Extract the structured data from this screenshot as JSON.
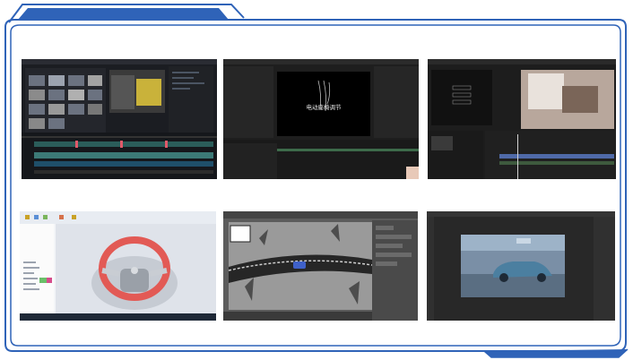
{
  "screenshots": [
    {
      "name": "video-editor-timeline"
    },
    {
      "name": "after-effects-title",
      "caption": "电动座椅调节"
    },
    {
      "name": "premiere-seat-edit"
    },
    {
      "name": "steering-wheel-3d-modeling"
    },
    {
      "name": "3ds-max-texture-viewport"
    },
    {
      "name": "photoshop-car-render"
    }
  ],
  "colors": {
    "frame": "#2f63b8",
    "tab": "#2f63b8"
  }
}
